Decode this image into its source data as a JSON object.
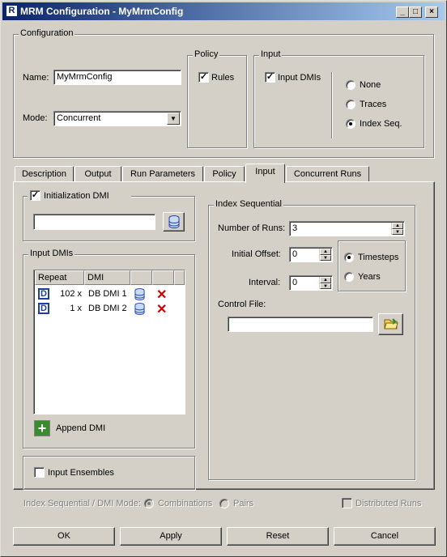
{
  "window": {
    "title": "MRM Configuration - MyMrmConfig",
    "min": "_",
    "max": "□",
    "close": "×"
  },
  "config": {
    "legend": "Configuration",
    "name_label": "Name:",
    "name_value": "MyMrmConfig",
    "mode_label": "Mode:",
    "mode_value": "Concurrent",
    "policy": {
      "legend": "Policy",
      "rules_label": "Rules",
      "rules_checked": true
    },
    "input": {
      "legend": "Input",
      "dmis_label": "Input DMIs",
      "dmis_checked": true,
      "options": [
        "None",
        "Traces",
        "Index Seq."
      ],
      "selected": "Index Seq."
    }
  },
  "tabs": [
    "Description",
    "Output",
    "Run Parameters",
    "Policy",
    "Input",
    "Concurrent Runs"
  ],
  "active_tab": "Input",
  "init_dmi": {
    "label": "Initialization DMI",
    "checked": true,
    "value": ""
  },
  "input_dmis": {
    "legend": "Input DMIs",
    "columns": [
      "Repeat",
      "DMI",
      "",
      ""
    ],
    "rows": [
      {
        "repeat": "102 x",
        "dmi": "DB DMI 1"
      },
      {
        "repeat": "1 x",
        "dmi": "DB DMI 2"
      }
    ],
    "append_label": "Append DMI"
  },
  "ensembles": {
    "label": "Input Ensembles",
    "checked": false
  },
  "index_seq": {
    "legend": "Index Sequential",
    "runs_label": "Number of Runs:",
    "runs_value": "3",
    "offset_label": "Initial Offset:",
    "offset_value": "0",
    "interval_label": "Interval:",
    "interval_value": "0",
    "units": [
      "Timesteps",
      "Years"
    ],
    "units_selected": "Timesteps",
    "control_label": "Control File:",
    "control_value": ""
  },
  "mode_row": {
    "label": "Index Sequential / DMI Mode:",
    "options": [
      "Combinations",
      "Pairs"
    ],
    "selected": "Combinations",
    "distributed_label": "Distributed Runs"
  },
  "buttons": {
    "ok": "OK",
    "apply": "Apply",
    "reset": "Reset",
    "cancel": "Cancel"
  },
  "colors": {
    "title_start": "#0a246a",
    "title_end": "#a6caf0",
    "face": "#d4d0c8",
    "delete_red": "#d00000",
    "dmi_blue": "#1f3fa0"
  }
}
